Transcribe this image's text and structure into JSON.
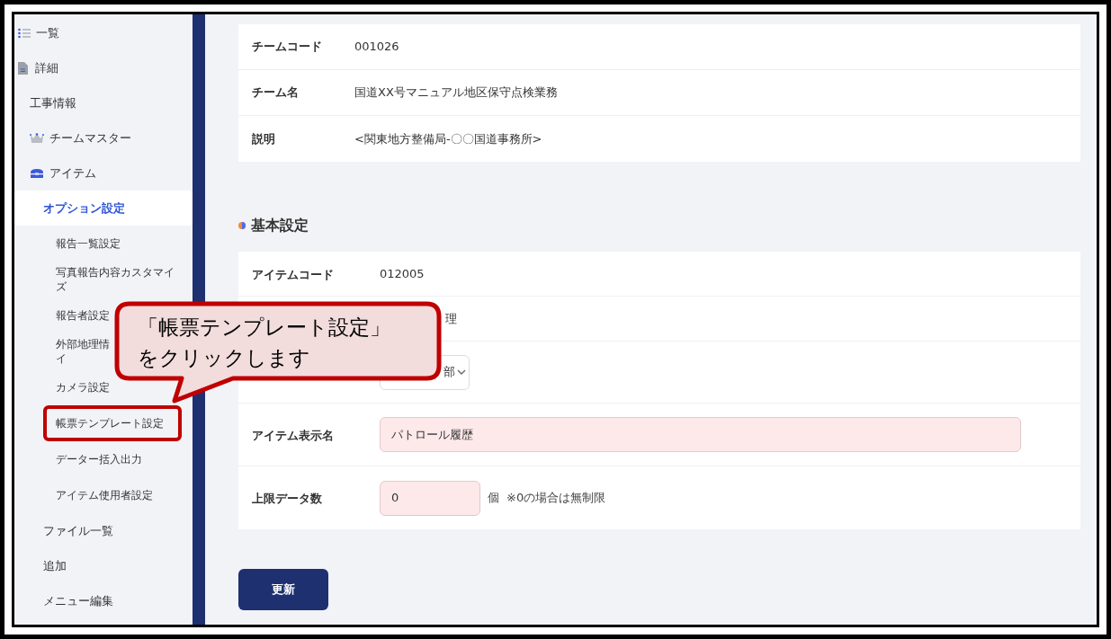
{
  "sidebar": {
    "items": [
      {
        "label": "一覧",
        "selected": false
      },
      {
        "label": "詳細",
        "selected": false,
        "children": [
          {
            "label": "工事情報",
            "selected": false
          },
          {
            "label": "チームマスター",
            "selected": false
          },
          {
            "label": "アイテム",
            "selected": false,
            "children": [
              {
                "label": "オプション設定",
                "selected": true,
                "children": [
                  {
                    "lines": [
                      "報告一覧設定"
                    ],
                    "highlighted": false
                  },
                  {
                    "lines": [
                      "写真報告内容カスタマイズ"
                    ],
                    "highlighted": false
                  },
                  {
                    "lines": [
                      "報告者設定"
                    ],
                    "highlighted": false
                  },
                  {
                    "lines": [
                      "外部地理情",
                      "イ"
                    ],
                    "highlighted": false
                  },
                  {
                    "lines": [
                      "カメラ設定"
                    ],
                    "highlighted": false
                  },
                  {
                    "lines": [
                      "帳票テンプレート設定"
                    ],
                    "highlighted": true
                  },
                  {
                    "lines": [
                      "データー括入出力"
                    ],
                    "highlighted": false
                  },
                  {
                    "lines": [
                      "アイテム使用者設定"
                    ],
                    "highlighted": false
                  }
                ]
              },
              {
                "label": "ファイル一覧",
                "selected": false
              },
              {
                "label": "追加",
                "selected": false
              },
              {
                "label": "メニュー編集",
                "selected": false
              }
            ]
          }
        ]
      }
    ]
  },
  "team_info": {
    "rows": [
      {
        "label": "チームコード",
        "value": "001026"
      },
      {
        "label": "チーム名",
        "value": "国道XX号マニュアル地区保守点検業務"
      },
      {
        "label": "説明",
        "value": "<関東地方整備局-〇〇国道事務所>"
      }
    ]
  },
  "basic_settings": {
    "title": "基本設定",
    "rows": [
      {
        "kind": "text",
        "label": "アイテムコード",
        "value": "012005"
      },
      {
        "kind": "text",
        "value": "理"
      },
      {
        "kind": "select",
        "value": "部"
      },
      {
        "kind": "input",
        "label": "アイテム表示名",
        "value": "パトロール履歴"
      },
      {
        "kind": "number",
        "label": "上限データ数",
        "value": "0",
        "unit": "個",
        "note": "※0の場合は無制限"
      }
    ]
  },
  "update_button": "更新",
  "callout": {
    "lines": [
      "「帳票テンプレート設定」",
      "をクリックします"
    ]
  }
}
